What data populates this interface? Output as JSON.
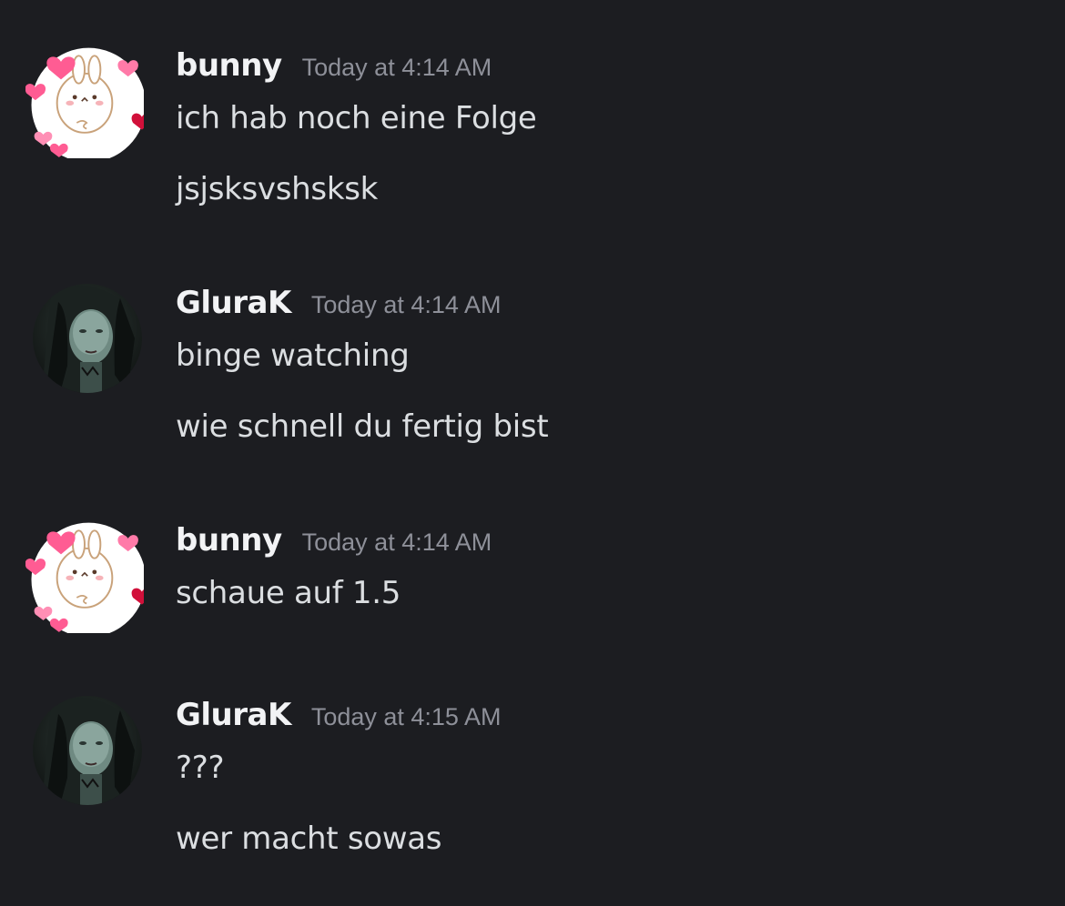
{
  "messages": [
    {
      "author": "bunny",
      "avatar_icon": "bunny-hearts-avatar-icon",
      "timestamp": "Today at 4:14 AM",
      "lines": [
        "ich hab noch eine Folge",
        "jsjsksvshsksk"
      ]
    },
    {
      "author": "GluraK",
      "avatar_icon": "dark-portrait-avatar-icon",
      "timestamp": "Today at 4:14 AM",
      "lines": [
        "binge watching",
        "wie schnell du fertig bist"
      ]
    },
    {
      "author": "bunny",
      "avatar_icon": "bunny-hearts-avatar-icon",
      "timestamp": "Today at 4:14 AM",
      "lines": [
        "schaue auf 1.5"
      ]
    },
    {
      "author": "GluraK",
      "avatar_icon": "dark-portrait-avatar-icon",
      "timestamp": "Today at 4:15 AM",
      "lines": [
        "???",
        "wer macht sowas"
      ]
    }
  ],
  "colors": {
    "background": "#1c1d21",
    "username": "#f2f3f5",
    "timestamp": "#8e9099",
    "message": "#dbdee1",
    "heart_pink": "#ff5c93",
    "heart_red": "#d1103a"
  }
}
